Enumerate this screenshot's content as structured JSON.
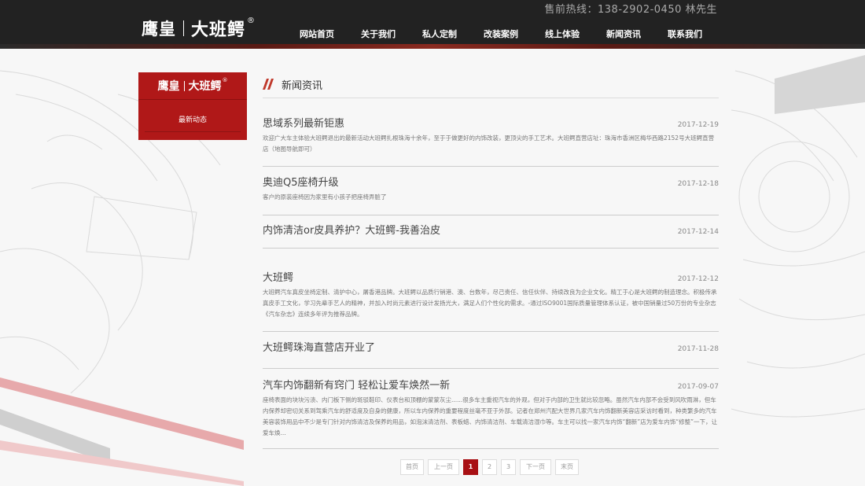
{
  "header": {
    "hotline": "售前热线：138-2902-0450 林先生",
    "logo": {
      "part1": "鹰皇",
      "part2": "大班鳄",
      "reg": "®"
    },
    "nav": [
      "网站首页",
      "关于我们",
      "私人定制",
      "改装案例",
      "线上体验",
      "新闻资讯",
      "联系我们"
    ]
  },
  "sidebar": {
    "logo": {
      "part1": "鹰皇",
      "part2": "大班鳄",
      "reg": "®"
    },
    "item": "最新动态"
  },
  "section": {
    "title": "新闻资讯"
  },
  "news": [
    {
      "title": "思域系列最新钜惠",
      "date": "2017-12-19",
      "desc": "欢迎广大车主体验大班鳄退出的最新活动大班鳄扎根珠海十余年，至于于做更好的内饰改装，更顶尖的手工艺术。大班鳄直营店址：珠海市香洲区梅华西路2152号大班鳄直营店（地图导航即可）"
    },
    {
      "title": "奥迪Q5座椅升级",
      "date": "2017-12-18",
      "desc": "客户的原装座椅因为家里有小孩子把座椅弄脏了"
    },
    {
      "title": "内饰清洁or皮具养护？大班鳄-我善治皮",
      "date": "2017-12-14",
      "desc": ""
    },
    {
      "title": "大班鳄",
      "date": "2017-12-12",
      "desc": "大班鳄汽车真皮坐椅定制、清护中心，屠香港品牌。大班鳄以品质行销港、澳、台数年，尽己责任、信任伙伴、持续改良为企业文化。精工于心是大班鳄的制造理念。积极传承真皮手工文化，学习先辈手艺人的精神，并加入时尚元素进行设计发扬光大，满足人们个性化的需求。-通过ISO9001国际质量管理体系认证，被中国销量过50万份的专业杂志《汽车杂志》连续多年评为推荐品牌。"
    },
    {
      "title": "大班鳄珠海直营店开业了",
      "date": "2017-11-28",
      "desc": ""
    },
    {
      "title": "汽车内饰翻新有窍门 轻松让爱车焕然一新",
      "date": "2017-09-07",
      "desc": "座椅表面的块块污渍、内门板下侧的斑驳鞋印、仪表台和顶棚的蒙蒙灰尘......很多车主重视汽车的外观，但对于内部的卫生就比较忽略。虽然汽车内部不会受到风吹雨淋，但车内保养却密切关系到驾乘汽车的舒适度及自身的健康，所以车内保养的重要程度丝毫不亚于外部。记者在郑州汽配大世界几家汽车内饰翻新美容店采访时看到，种类繁多的汽车美容装饰用品中不少是专门针对内饰清洁及保养的用品，如泡沫清洁剂、表板蜡、内饰清洁剂、车载清洁湿巾等。车主可以找一家汽车内饰“翻新”店为爱车内饰“修整”一下，让爱车焕..."
    }
  ],
  "pagination": {
    "first": "首页",
    "prev": "上一页",
    "pages": [
      "1",
      "2",
      "3"
    ],
    "current": "1",
    "next": "下一页",
    "last": "末页"
  },
  "colors": {
    "header_bg": "#222222",
    "accent_red": "#b01818",
    "page_bg": "#f7f7f7"
  }
}
